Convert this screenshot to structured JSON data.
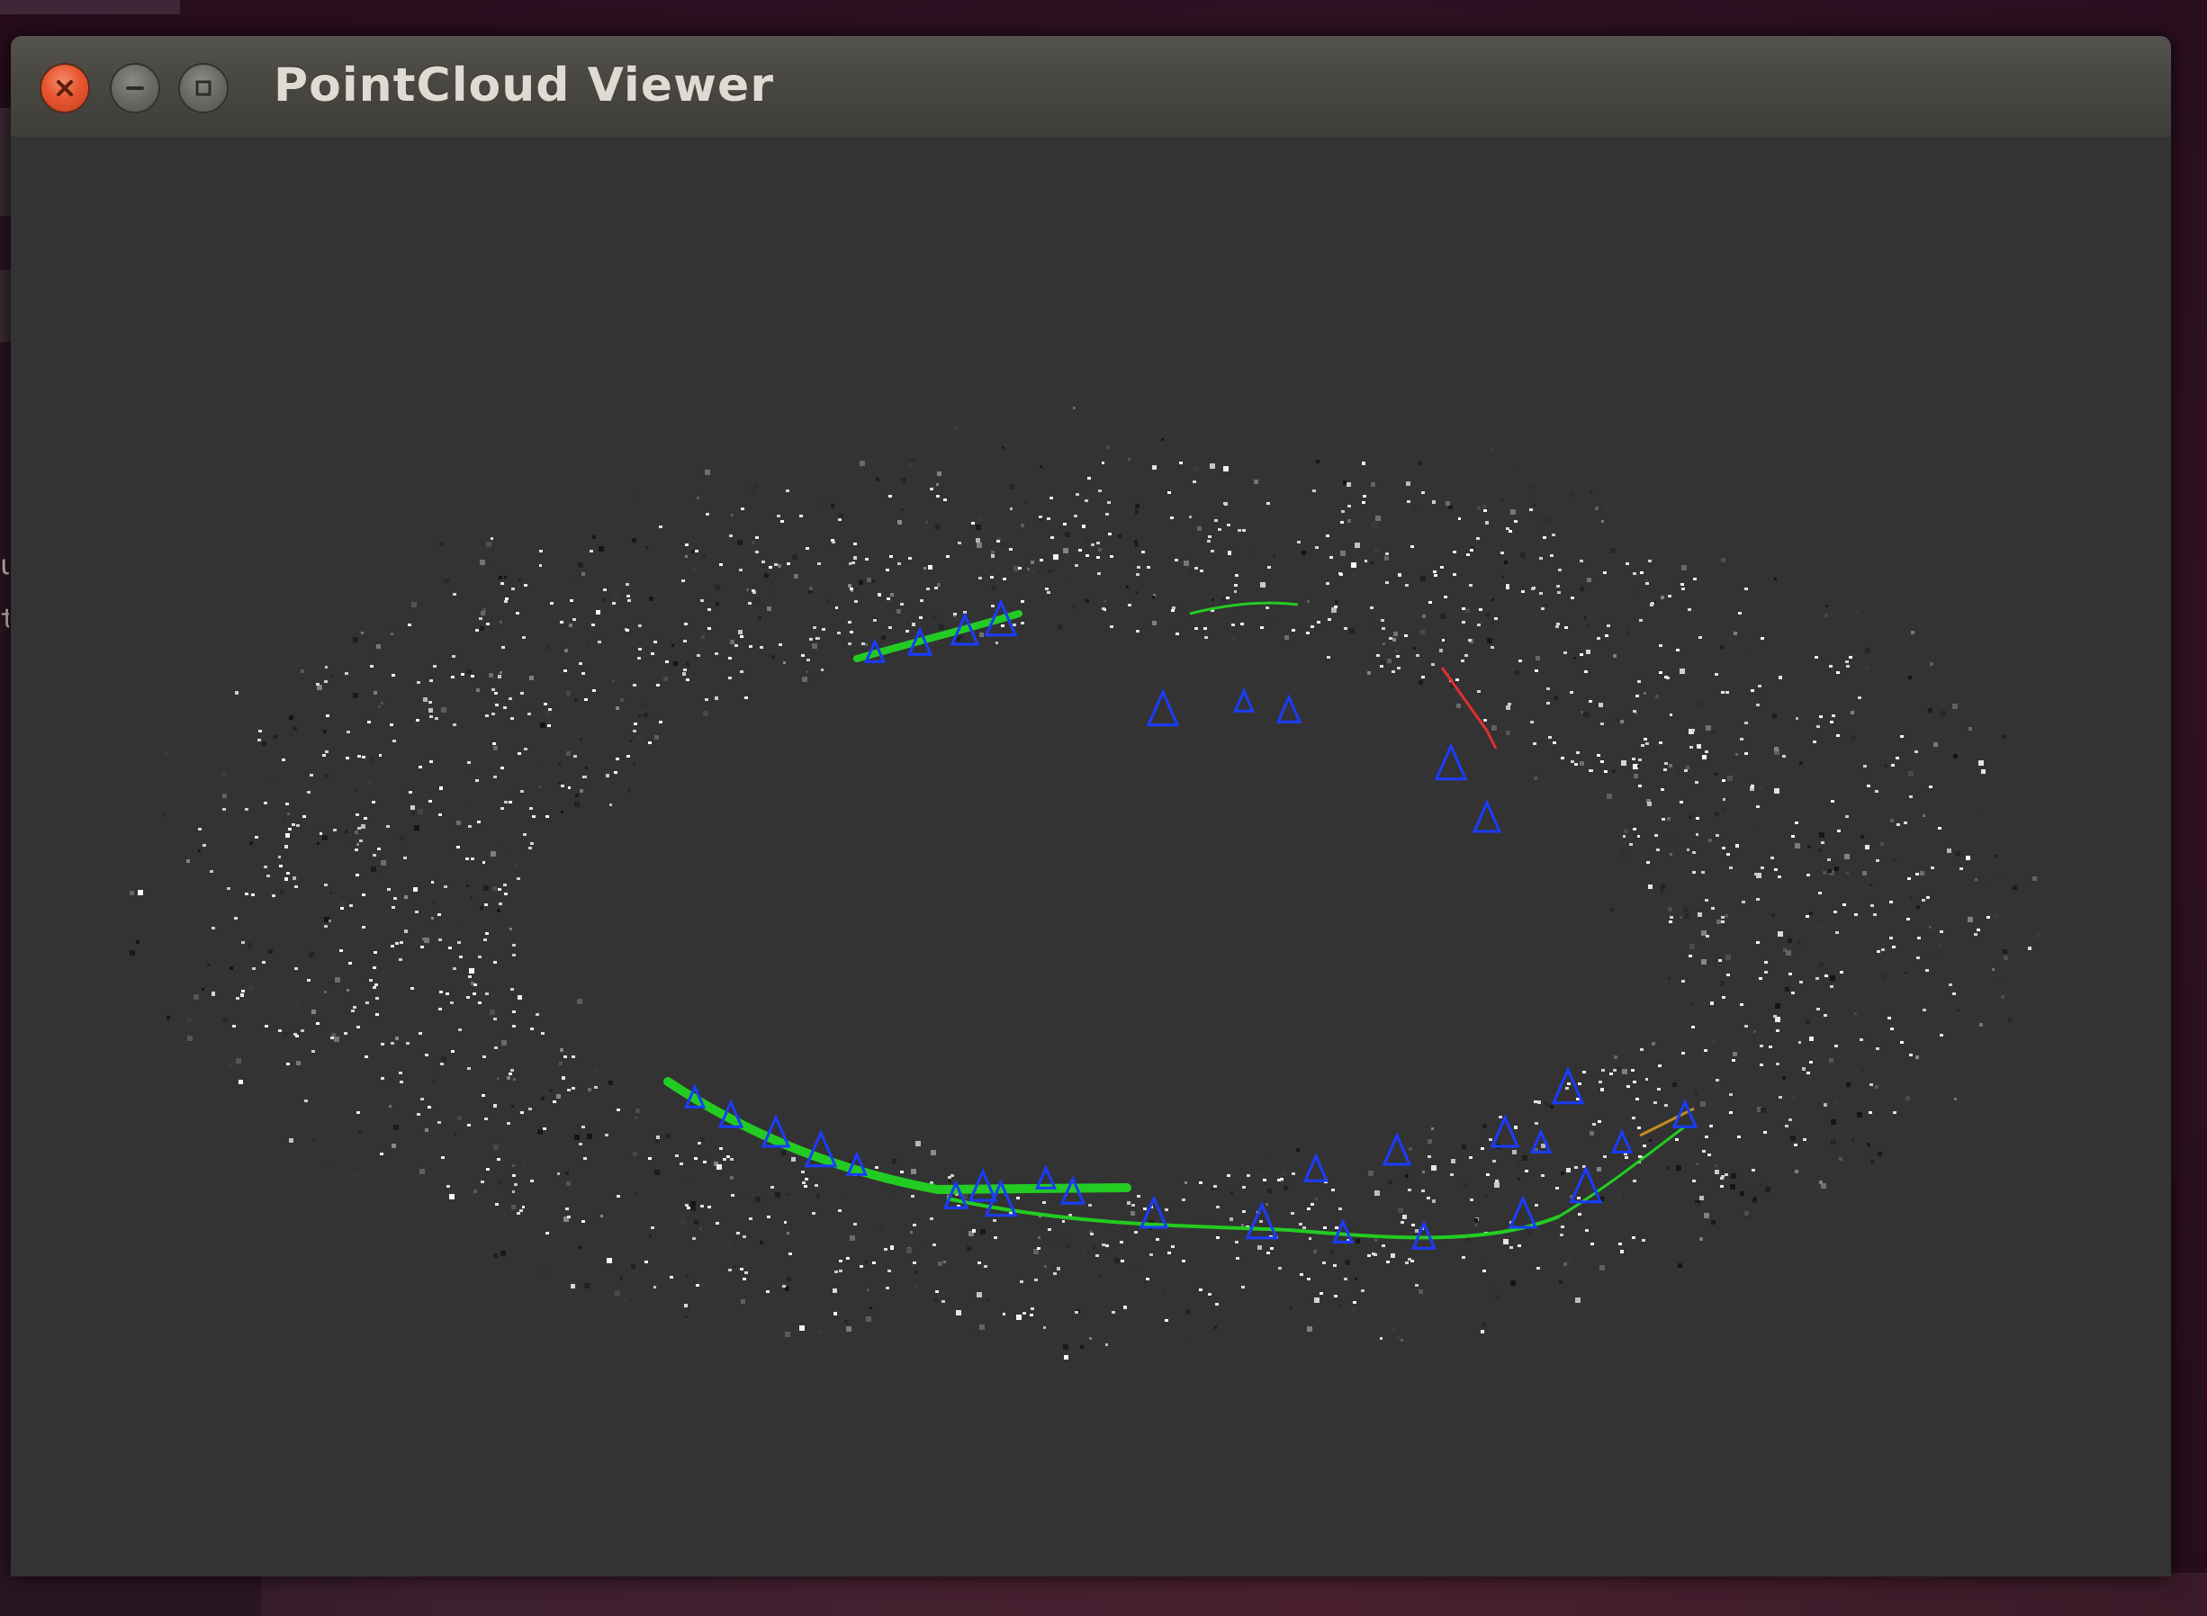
{
  "window": {
    "title": "PointCloud Viewer"
  },
  "titlebar_buttons": [
    {
      "name": "close",
      "icon": "close-icon",
      "color": "#e8562f"
    },
    {
      "name": "minimize",
      "icon": "minimize-icon",
      "color": "#6b6964"
    },
    {
      "name": "maximize",
      "icon": "maximize-icon",
      "color": "#6b6964"
    }
  ],
  "desktop": {
    "left_edge_text": [
      "u",
      "t"
    ]
  },
  "viewer": {
    "background_color": "#333333",
    "point_color": "grayscale",
    "trajectory_color": "#22cc22",
    "camera_frustum_color": "#1a3cff"
  }
}
